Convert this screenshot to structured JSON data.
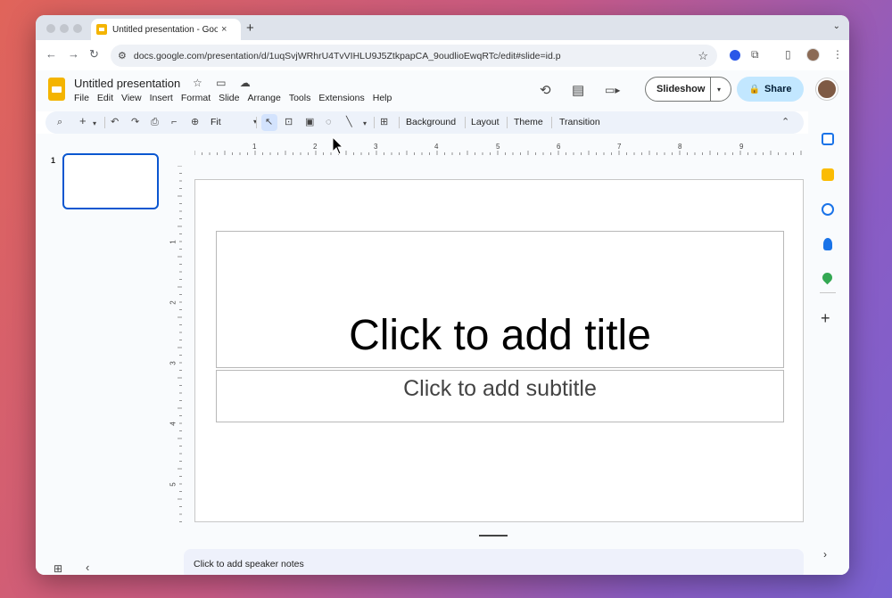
{
  "browser": {
    "tab_title": "Untitled presentation - Google Slides",
    "tab_close": "×",
    "new_tab": "+",
    "url": "docs.google.com/presentation/d/1uqSvjWRhrU4TvVIHLU9J5ZtkpapCA_9oudlioEwqRTc/edit#slide=id.p",
    "back_icon": "←",
    "forward_icon": "→",
    "reload_icon": "↻",
    "tune_icon": "⚙",
    "star_icon": "☆",
    "puzzle_icon": "⧉",
    "sidebar_icon": "▯",
    "more_icon": "⋮",
    "tab_menu_icon": "⌄"
  },
  "app": {
    "doc_title": "Untitled presentation",
    "title_icons": "☆ ▭ ☁",
    "menus": [
      "File",
      "Edit",
      "View",
      "Insert",
      "Format",
      "Slide",
      "Arrange",
      "Tools",
      "Extensions",
      "Help"
    ],
    "history_icon": "⟲",
    "comment_icon": "▤",
    "meet_icon": "▭▸",
    "slideshow_label": "Slideshow",
    "slideshow_dd": "▾",
    "share_label": "Share",
    "lock_icon": "🔒"
  },
  "toolbar": {
    "search_icon": "⌕",
    "add_icon": "+",
    "add_dd": "▾",
    "undo_icon": "↶",
    "redo_icon": "↷",
    "print_icon": "⎙",
    "paint_icon": "⌐",
    "zoom_icon": "⊕",
    "zoom_value": "Fit",
    "zoom_dd": "▾",
    "select_icon": "↖",
    "textbox_icon": "⊡",
    "image_icon": "▣",
    "shape_icon": "◌",
    "line_icon": "╲",
    "line_dd": "▾",
    "comment_add_icon": "⊞",
    "background_label": "Background",
    "layout_label": "Layout",
    "theme_label": "Theme",
    "transition_label": "Transition",
    "collapse_icon": "⌃"
  },
  "filmstrip": {
    "slide_number": "1"
  },
  "rulers": {
    "horizontal": [
      "1",
      "2",
      "3",
      "4",
      "5",
      "6",
      "7",
      "8",
      "9"
    ],
    "vertical": [
      "1",
      "2",
      "3",
      "4",
      "5"
    ]
  },
  "slide": {
    "title_placeholder": "Click to add title",
    "subtitle_placeholder": "Click to add subtitle"
  },
  "notes": {
    "placeholder": "Click to add speaker notes"
  },
  "bottom": {
    "grid_icon": "⊞",
    "collapse_icon": "‹",
    "expand_icon": "›"
  },
  "side_panel": {
    "add_icon": "+",
    "colors": {
      "calendar": "#1a73e8",
      "keep": "#fbbc04",
      "tasks": "#1a73e8",
      "contacts": "#1a73e8",
      "maps": "#34a853"
    }
  },
  "colors": {
    "accent": "#0b57d0",
    "share_bg": "#c2e7ff",
    "toolbar_bg": "#edf2fa",
    "slides_yellow": "#f4b400"
  }
}
